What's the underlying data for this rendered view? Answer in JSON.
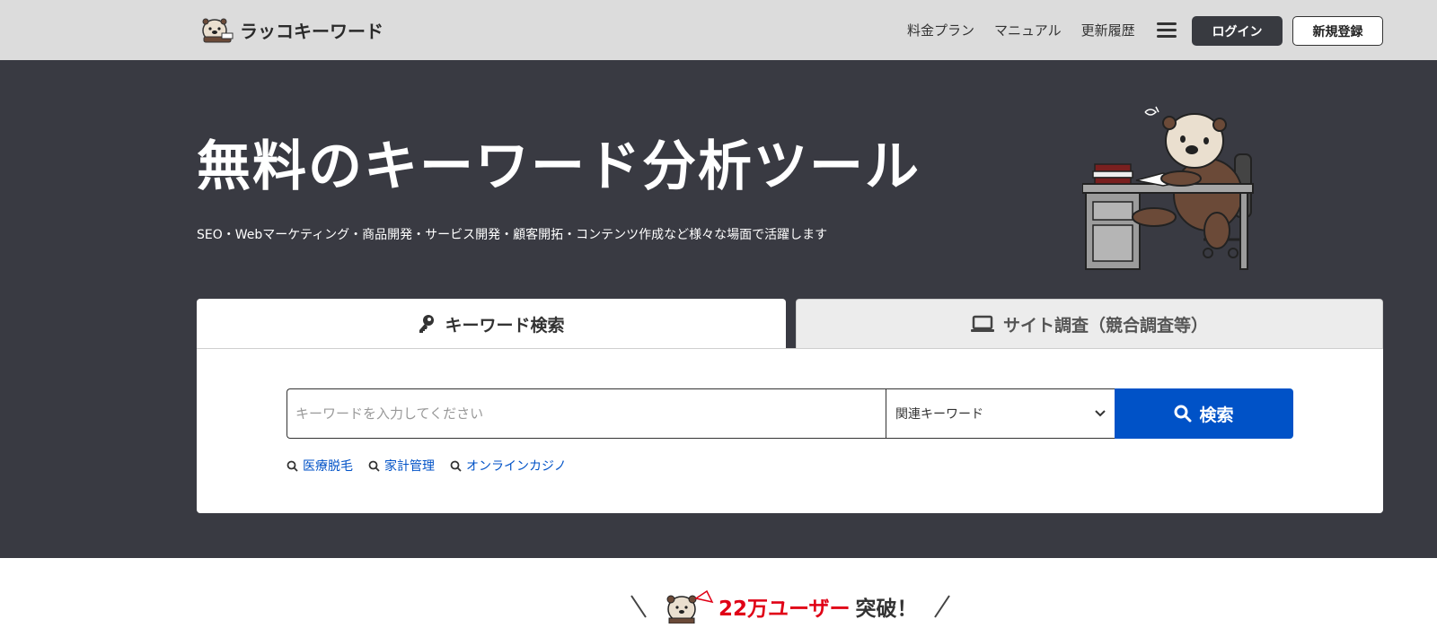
{
  "header": {
    "logo_text": "ラッコキーワード",
    "nav": [
      "料金プラン",
      "マニュアル",
      "更新履歴"
    ],
    "login_label": "ログイン",
    "register_label": "新規登録"
  },
  "hero": {
    "title": "無料のキーワード分析ツール",
    "subtitle": "SEO・Webマーケティング・商品開発・サービス開発・顧客開拓・コンテンツ作成など様々な場面で活躍します"
  },
  "tabs": {
    "keyword_search": "キーワード検索",
    "site_research": "サイト調査（競合調査等）"
  },
  "search": {
    "placeholder": "キーワードを入力してください",
    "mode_selected": "関連キーワード",
    "button_label": "検索",
    "accent_color": "#0052c7"
  },
  "suggestions": [
    "医療脱毛",
    "家計管理",
    "オンラインカジノ"
  ],
  "users_banner": {
    "count_text": "22万ユーザー",
    "suffix": "突破！",
    "count_color": "#e00016"
  }
}
